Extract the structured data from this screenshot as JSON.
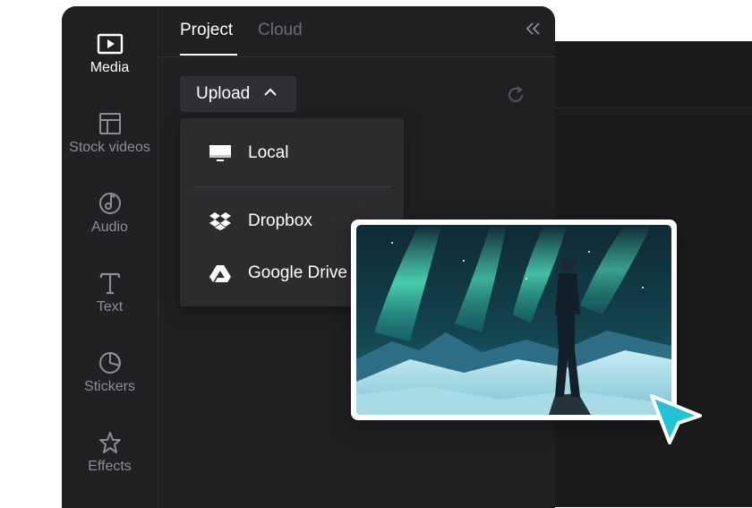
{
  "sidebar": {
    "items": [
      {
        "label": "Media",
        "icon": "media-icon",
        "active": true
      },
      {
        "label": "Stock videos",
        "icon": "stock-videos-icon",
        "active": false
      },
      {
        "label": "Audio",
        "icon": "audio-icon",
        "active": false
      },
      {
        "label": "Text",
        "icon": "text-icon",
        "active": false
      },
      {
        "label": "Stickers",
        "icon": "stickers-icon",
        "active": false
      },
      {
        "label": "Effects",
        "icon": "effects-icon",
        "active": false
      }
    ]
  },
  "tabs": [
    {
      "label": "Project",
      "active": true
    },
    {
      "label": "Cloud",
      "active": false
    }
  ],
  "upload": {
    "label": "Upload",
    "menu": [
      {
        "label": "Local",
        "icon": "monitor-icon"
      },
      {
        "label": "Dropbox",
        "icon": "dropbox-icon"
      },
      {
        "label": "Google Drive",
        "icon": "google-drive-icon"
      }
    ]
  },
  "colors": {
    "panel": "#1f1f21",
    "accent_cursor": "#22c3d6",
    "text_active": "#ffffff",
    "text_muted": "#8d8d92"
  }
}
